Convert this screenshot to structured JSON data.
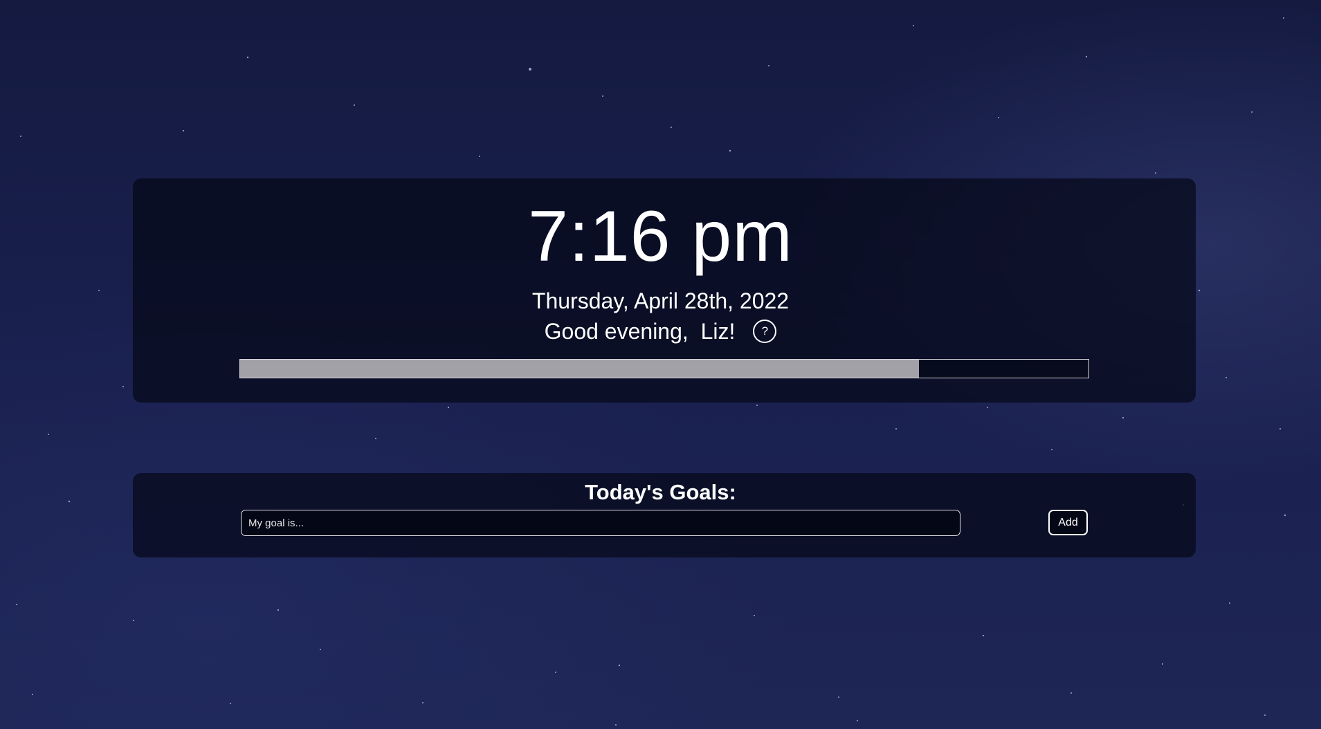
{
  "clock": {
    "time": "7:16 pm",
    "date": "Thursday, April 28th, 2022",
    "greeting": "Good evening,  Liz!",
    "help_label": "?"
  },
  "day_progress": {
    "fraction": 0.8
  },
  "goals": {
    "title": "Today's Goals:",
    "input_value": "",
    "input_placeholder": "My goal is...",
    "add_label": "Add"
  },
  "colors": {
    "background": "#1a2150",
    "panel": "#050818",
    "text": "#ffffff",
    "progress_fill": "#a1a1a7",
    "progress_border": "#d8d8de"
  }
}
